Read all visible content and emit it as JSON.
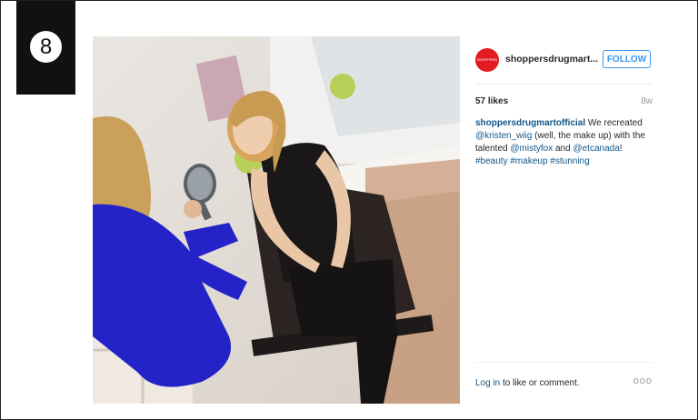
{
  "badge": {
    "number": "8"
  },
  "post": {
    "account_logo_text": "SHOPPERS DRUG MART",
    "username": "shoppersdrugmart...",
    "follow_label": "FOLLOW",
    "likes": "57 likes",
    "age": "8w",
    "caption": {
      "author": "shoppersdrugmartofficial",
      "t1": " We recreated ",
      "mention1": "@kristen_wiig",
      "t2": " (well, the make up) with the talented ",
      "mention2": "@mistyfox",
      "t3": " and ",
      "mention3": "@etcanada",
      "t4": "!",
      "tag1": "#beauty",
      "tag2": "#makeup",
      "tag3": "#stunning"
    },
    "login_link": "Log in",
    "login_rest": " to like or comment.",
    "more_label": "ooo"
  },
  "colors": {
    "accent": "#3897f0",
    "link": "#125688",
    "logo": "#e31b23"
  }
}
